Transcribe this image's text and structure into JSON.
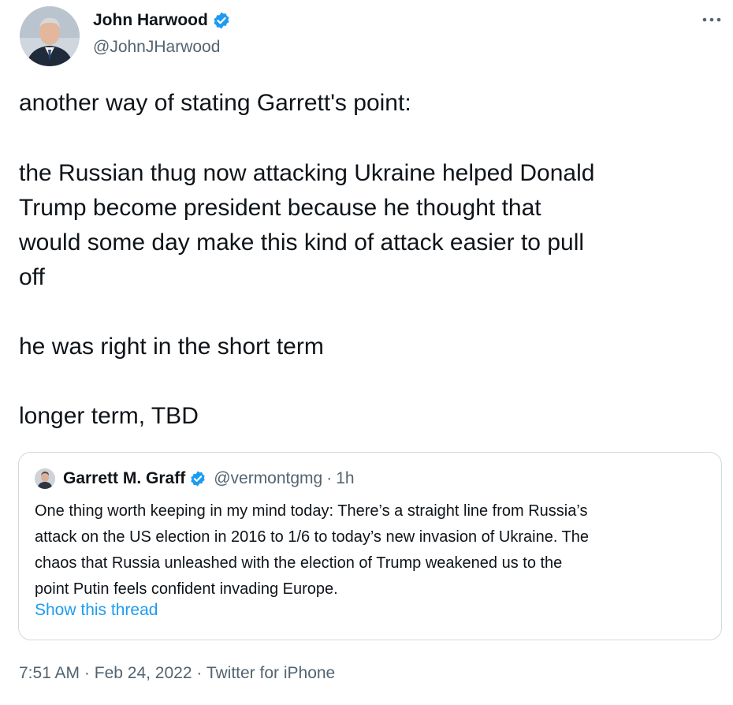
{
  "colors": {
    "text": "#0f1419",
    "secondary": "#536471",
    "link": "#1d9bf0",
    "verified": "#1d9bf0",
    "border": "#cfd9de"
  },
  "author": {
    "name": "John Harwood",
    "handle": "@JohnJHarwood",
    "verified_icon": "verified-badge-icon"
  },
  "menu": {
    "icon": "more-dots-icon"
  },
  "tweet": {
    "lines": [
      "another way of stating Garrett's point:",
      "the Russian thug now attacking Ukraine helped Donald",
      "Trump become president because he thought that",
      "would some day make this kind of attack easier to pull",
      "off",
      "he was right in the short term",
      "longer term, TBD"
    ]
  },
  "quote": {
    "name": "Garrett M. Graff",
    "handle": "@vermontgmg",
    "separator": "·",
    "age": "1h",
    "lines": [
      "One thing worth keeping in my mind today: There’s a straight line from Russia’s",
      "attack on the US election in 2016 to 1/6 to today’s new invasion of Ukraine. The",
      "chaos that Russia unleashed with the election of Trump weakened us to the",
      "point Putin feels confident invading Europe."
    ],
    "show_thread": "Show this thread"
  },
  "meta": {
    "time": "7:51 AM",
    "date": "Feb 24, 2022",
    "source": "Twitter for iPhone",
    "separator": "·"
  }
}
